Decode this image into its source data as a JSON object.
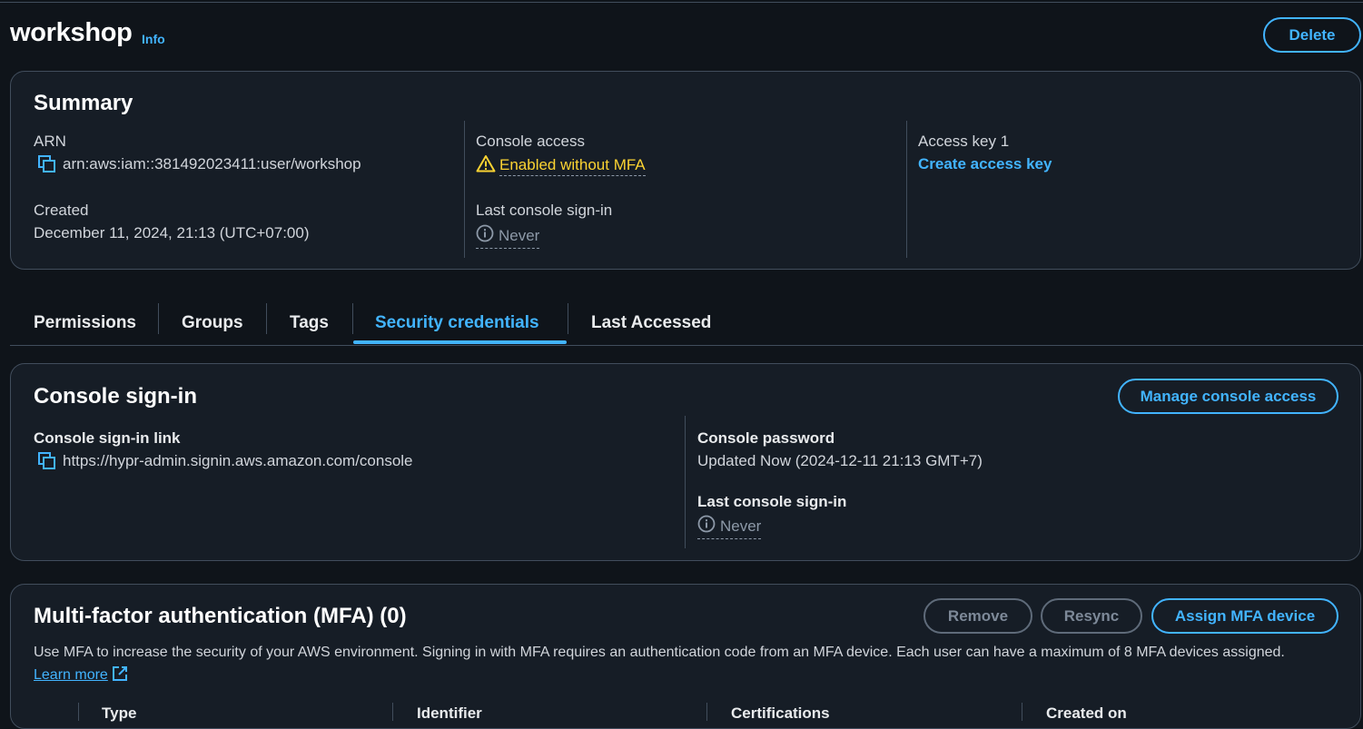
{
  "header": {
    "title": "workshop",
    "info_label": "Info",
    "delete_label": "Delete"
  },
  "summary": {
    "heading": "Summary",
    "arn_label": "ARN",
    "arn_value": "arn:aws:iam::381492023411:user/workshop",
    "created_label": "Created",
    "created_value": "December 11, 2024, 21:13 (UTC+07:00)",
    "console_access_label": "Console access",
    "console_access_value": "Enabled without MFA",
    "last_signin_label": "Last console sign-in",
    "last_signin_value": "Never",
    "access_key_label": "Access key 1",
    "create_access_key_label": "Create access key"
  },
  "tabs": [
    {
      "label": "Permissions"
    },
    {
      "label": "Groups"
    },
    {
      "label": "Tags"
    },
    {
      "label": "Security credentials",
      "active": true
    },
    {
      "label": "Last Accessed"
    }
  ],
  "console_signin": {
    "heading": "Console sign-in",
    "manage_label": "Manage console access",
    "link_label": "Console sign-in link",
    "link_value": "https://hypr-admin.signin.aws.amazon.com/console",
    "password_label": "Console password",
    "password_value": "Updated Now (2024-12-11 21:13 GMT+7)",
    "last_signin_label": "Last console sign-in",
    "last_signin_value": "Never"
  },
  "mfa": {
    "heading": "Multi-factor authentication (MFA) (0)",
    "remove_label": "Remove",
    "resync_label": "Resync",
    "assign_label": "Assign MFA device",
    "description": "Use MFA to increase the security of your AWS environment. Signing in with MFA requires an authentication code from an MFA device. Each user can have a maximum of 8 MFA devices assigned.",
    "learn_more": "Learn more",
    "columns": [
      "Type",
      "Identifier",
      "Certifications",
      "Created on"
    ]
  },
  "colors": {
    "accent": "#42b4ff",
    "warning": "#fbd332",
    "background": "#0f141a",
    "panel": "#161d26"
  }
}
